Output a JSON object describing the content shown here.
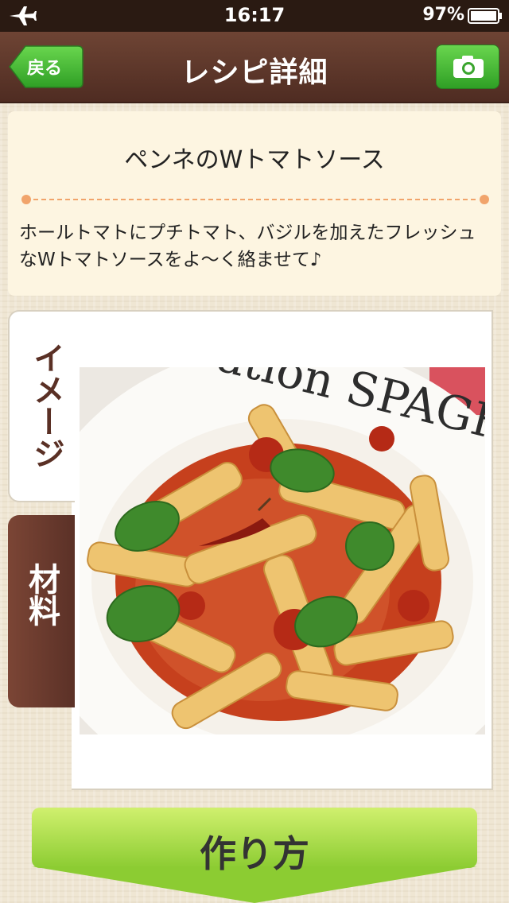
{
  "status_bar": {
    "time": "16:17",
    "battery": "97%",
    "airplane_icon": "airplane-icon",
    "battery_icon": "battery-icon"
  },
  "nav": {
    "title": "レシピ詳細",
    "back_label": "戻る",
    "camera_icon": "camera-icon"
  },
  "recipe": {
    "title": "ペンネのWトマトソース",
    "description": "ホールトマトにプチトマト、バジルを加えたフレッシュなWトマトソースをよ〜く絡ませて♪"
  },
  "tabs": [
    {
      "label": "イメージ",
      "active": true
    },
    {
      "label": "材料",
      "active": false
    }
  ],
  "photo": {
    "plate_text": "ation SPAGHE"
  },
  "bottom_button": {
    "label": "作り方"
  },
  "colors": {
    "nav_brown": "#5e3729",
    "card_cream": "#fdf5e1",
    "accent_orange": "#f1a46b",
    "button_green": "#9cd63f"
  }
}
